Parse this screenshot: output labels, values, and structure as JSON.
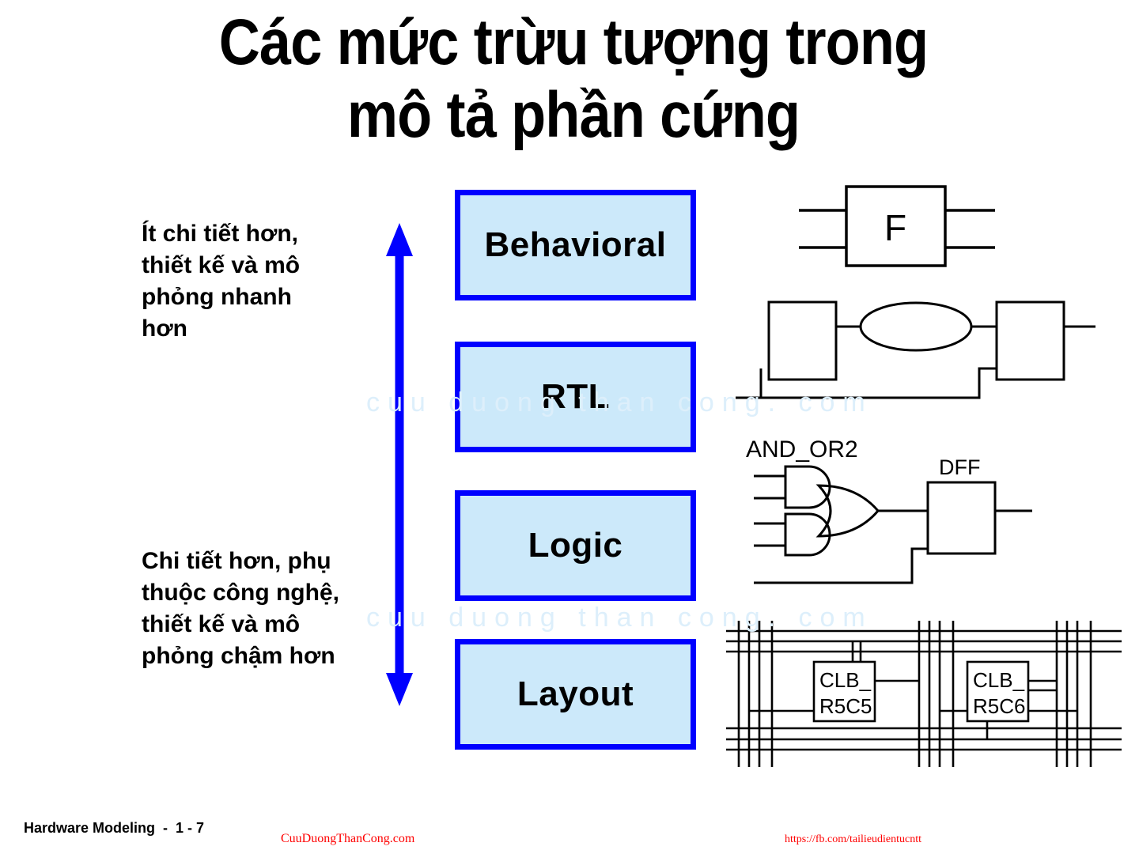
{
  "slide": {
    "title": "Các mức trừu tượng trong\nmô tả phần cứng",
    "colors": {
      "box_fill": "#cce9fa",
      "box_border": "#0000ff",
      "arrow": "#0000ff",
      "text": "#000000",
      "watermark": "#ddeffb",
      "footer_accent": "#ff0000"
    }
  },
  "notes": {
    "top": "Ít chi tiết hơn,\nthiết kế và mô\nphỏng nhanh\nhơn",
    "bottom": "Chi tiết hơn, phụ\nthuộc công nghệ,\nthiết kế và mô\nphỏng chậm hơn"
  },
  "arrow": {
    "name": "double-headed-vertical-arrow",
    "direction": "both",
    "color": "#0000ff"
  },
  "levels": [
    {
      "id": "behavioral",
      "label": "Behavioral"
    },
    {
      "id": "rtl",
      "label": "RTL"
    },
    {
      "id": "logic",
      "label": "Logic"
    },
    {
      "id": "layout",
      "label": "Layout"
    }
  ],
  "diagrams": {
    "behavioral": {
      "block_label": "F",
      "description": "function block with two inputs and two outputs"
    },
    "rtl": {
      "description": "register block, combinational cloud (ellipse), register block with feedback path",
      "labels": []
    },
    "logic": {
      "gate_group_label": "AND_OR2",
      "flipflop_label": "DFF",
      "description": "two AND gates feeding an OR gate driving a D flip-flop"
    },
    "layout": {
      "cells": [
        "CLB_\nR5C5",
        "CLB_\nR5C6"
      ],
      "cell_labels": [
        {
          "line1": "CLB_",
          "line2": "R5C5"
        },
        {
          "line1": "CLB_",
          "line2": "R5C6"
        }
      ],
      "description": "FPGA routing channels with two configurable logic blocks"
    }
  },
  "watermarks": {
    "line_1": "cuu duong than cong. com",
    "line_2": "cuu duong than cong. com"
  },
  "footer": {
    "left": "Hardware Modeling  -  1 - 7",
    "center": "CuuDuongThanCong.com",
    "right": "https://fb.com/tailieudientucntt"
  }
}
